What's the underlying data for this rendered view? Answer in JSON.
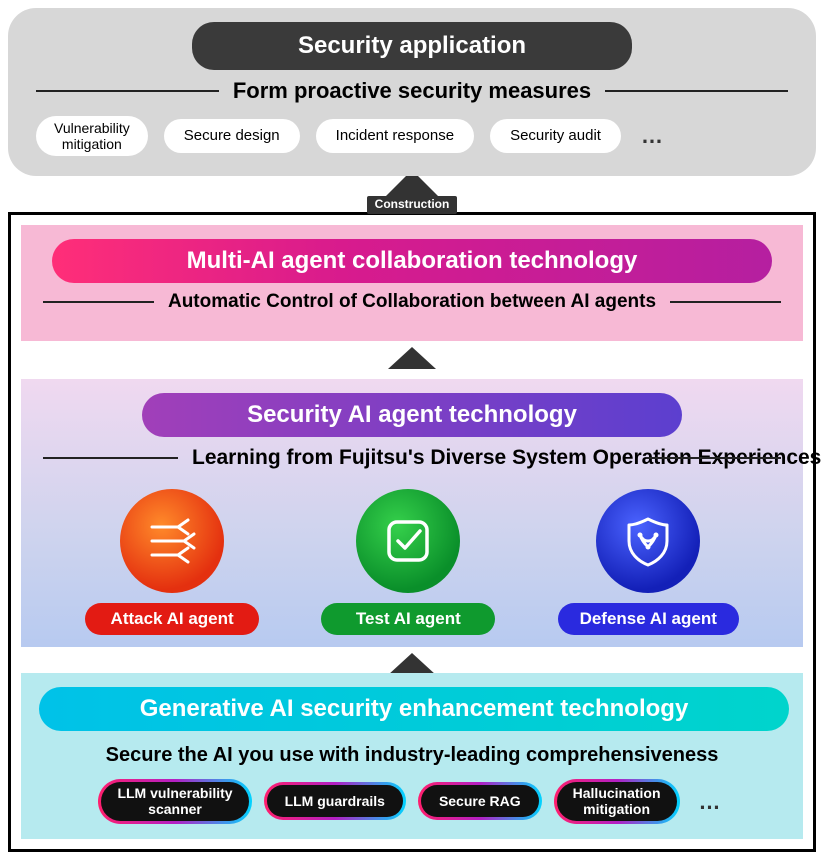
{
  "top": {
    "title": "Security application",
    "subtitle": "Form proactive security measures",
    "pills": {
      "p1": "Vulnerability\nmitigation",
      "p2": "Secure design",
      "p3": "Incident response",
      "p4": "Security audit"
    },
    "more": "…"
  },
  "construction_label": "Construction",
  "multi": {
    "title": "Multi-AI agent collaboration technology",
    "subtitle": "Automatic Control of Collaboration between AI agents"
  },
  "security": {
    "title": "Security AI agent technology",
    "subtitle": "Learning from Fujitsu's Diverse System Operation Experiences",
    "agents": {
      "attack": "Attack AI agent",
      "test": "Test AI agent",
      "defense": "Defense AI agent"
    }
  },
  "gen": {
    "title": "Generative AI security enhancement technology",
    "subtitle": "Secure the AI you use with industry-leading comprehensiveness",
    "pills": {
      "p1": "LLM vulnerability\nscanner",
      "p2": "LLM guardrails",
      "p3": "Secure RAG",
      "p4": "Hallucination\nmitigation"
    },
    "more": "…"
  }
}
